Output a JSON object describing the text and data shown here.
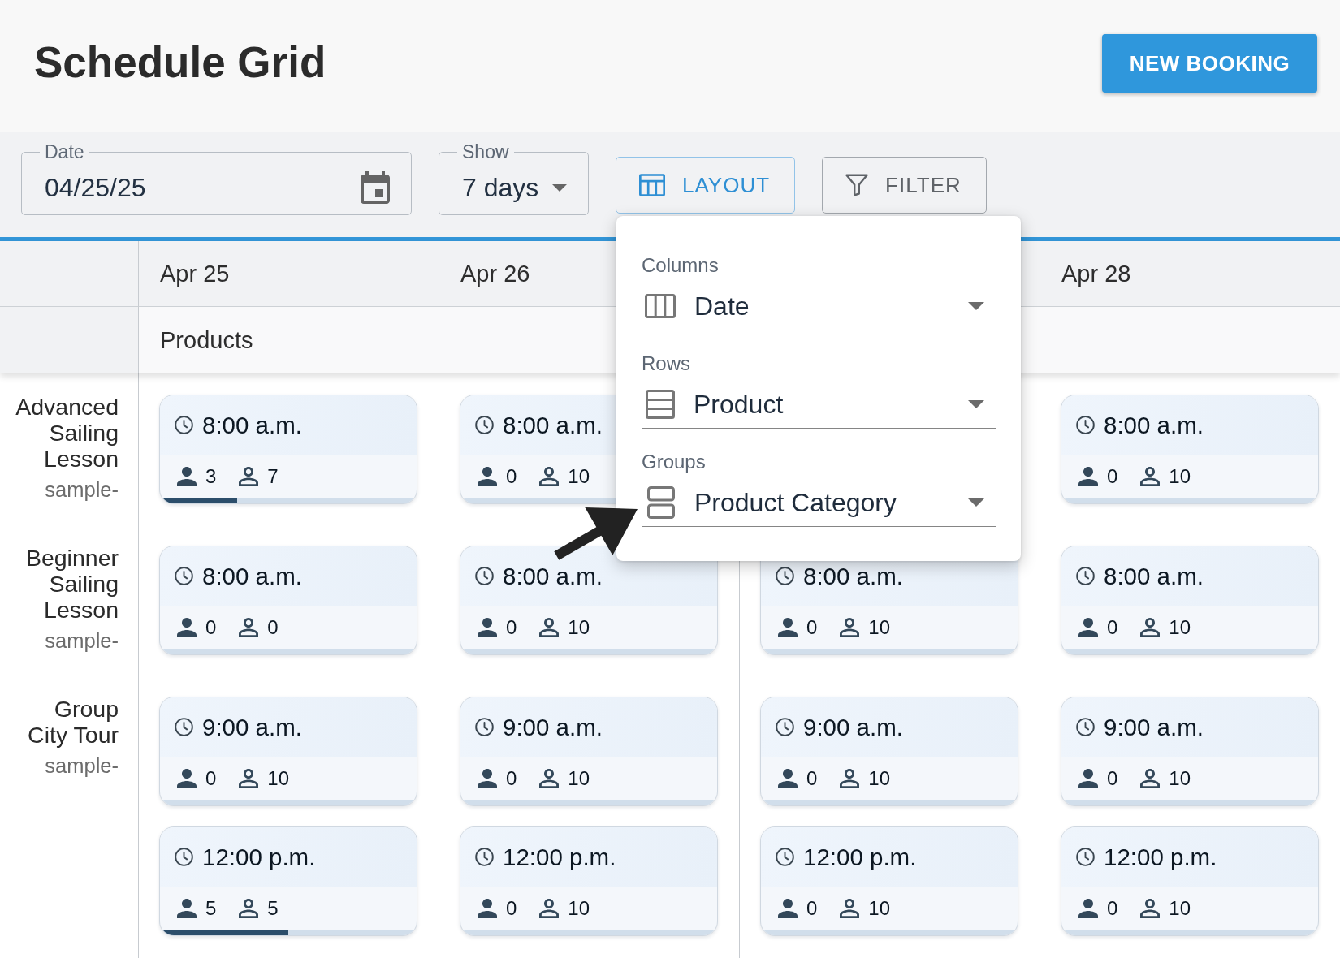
{
  "header": {
    "title": "Schedule Grid",
    "action": "NEW BOOKING"
  },
  "toolbar": {
    "date_field": {
      "label": "Date",
      "value": "04/25/25"
    },
    "show_field": {
      "label": "Show",
      "value": "7 days"
    },
    "buttons": [
      {
        "label": "LAYOUT",
        "kind": "layout",
        "selected": true
      },
      {
        "label": "FILTER",
        "kind": "filter",
        "selected": false
      }
    ]
  },
  "layout_menu": {
    "fields": [
      {
        "label": "Columns",
        "value": "Date",
        "kind": "columns"
      },
      {
        "label": "Rows",
        "value": "Product",
        "kind": "rows"
      },
      {
        "label": "Groups",
        "value": "Product Category",
        "kind": "groups"
      }
    ]
  },
  "grid": {
    "columns": [
      {
        "label": "Apr 25"
      },
      {
        "label": "Apr 26"
      },
      {},
      {
        "label": "Apr 28"
      }
    ],
    "group_header": "Products",
    "rows": [
      {
        "name": "Advanced Sailing Lesson",
        "code": "sample-",
        "cells": [
          {
            "sessions": [
              {
                "time": "8:00 a.m.",
                "booked": "3",
                "available": "7",
                "level": 0.3
              }
            ]
          },
          {
            "sessions": [
              {
                "time": "8:00 a.m.",
                "booked": "0",
                "available": "10"
              }
            ]
          },
          {},
          {
            "sessions": [
              {
                "time": "8:00 a.m.",
                "booked": "0",
                "available": "10"
              }
            ]
          }
        ]
      },
      {
        "name": "Beginner Sailing Lesson",
        "code": "sample-",
        "cells": [
          {
            "sessions": [
              {
                "time": "8:00 a.m.",
                "booked": "0",
                "available": "0"
              }
            ]
          },
          {
            "sessions": [
              {
                "time": "8:00 a.m.",
                "booked": "0",
                "available": "10"
              }
            ]
          },
          {
            "sessions": [
              {
                "time": "8:00 a.m.",
                "booked": "0",
                "available": "10"
              }
            ]
          },
          {
            "sessions": [
              {
                "time": "8:00 a.m.",
                "booked": "0",
                "available": "10"
              }
            ]
          }
        ]
      },
      {
        "name": "Group City Tour",
        "code": "sample-",
        "cells": [
          {
            "sessions": [
              {
                "time": "9:00 a.m.",
                "booked": "0",
                "available": "10"
              },
              {
                "time": "12:00 p.m.",
                "booked": "5",
                "available": "5",
                "level": 0.5
              }
            ]
          },
          {
            "sessions": [
              {
                "time": "9:00 a.m.",
                "booked": "0",
                "available": "10"
              },
              {
                "time": "12:00 p.m.",
                "booked": "0",
                "available": "10"
              }
            ]
          },
          {
            "sessions": [
              {
                "time": "9:00 a.m.",
                "booked": "0",
                "available": "10"
              },
              {
                "time": "12:00 p.m.",
                "booked": "0",
                "available": "10"
              }
            ]
          },
          {
            "sessions": [
              {
                "time": "9:00 a.m.",
                "booked": "0",
                "available": "10"
              },
              {
                "time": "12:00 p.m.",
                "booked": "0",
                "available": "10"
              }
            ]
          }
        ]
      }
    ]
  }
}
